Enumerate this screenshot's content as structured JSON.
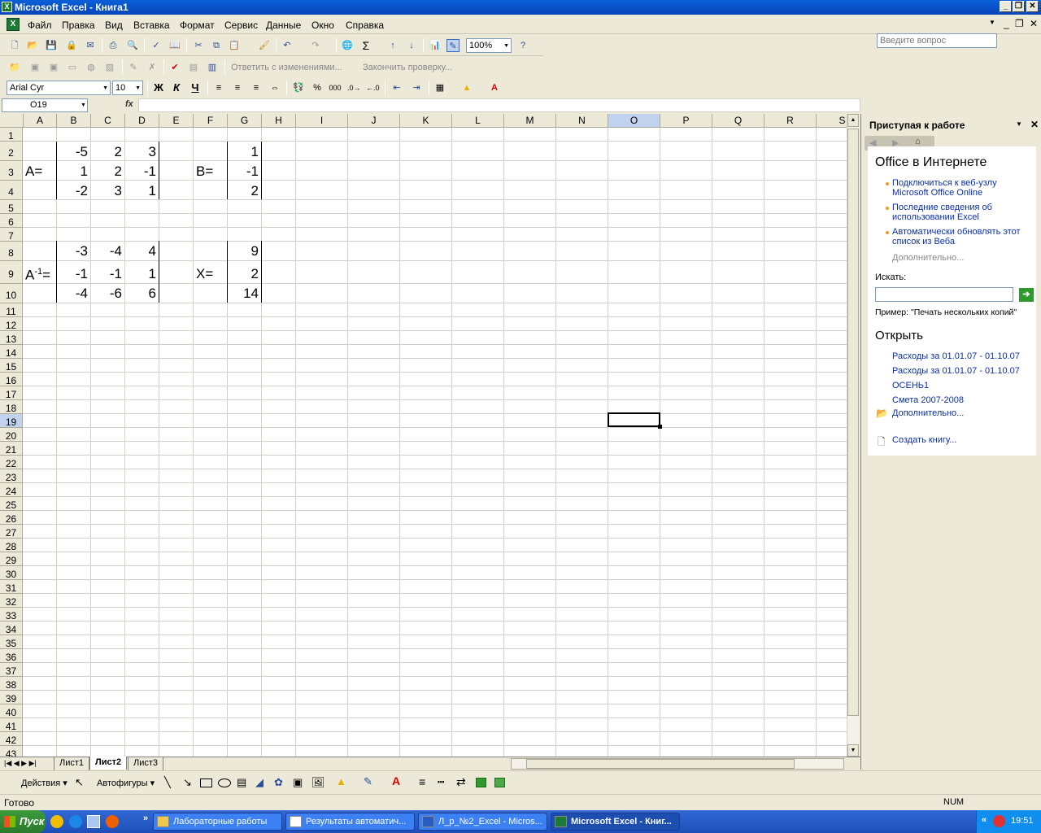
{
  "window": {
    "title": "Microsoft Excel - Книга1"
  },
  "menu": {
    "items": [
      "Файл",
      "Правка",
      "Вид",
      "Вставка",
      "Формат",
      "Сервис",
      "Данные",
      "Окно",
      "Справка"
    ],
    "ask_placeholder": "Введите вопрос"
  },
  "toolbar": {
    "zoom": "100%",
    "reviewing": {
      "reply_label": "Ответить с изменениями...",
      "end_label": "Закончить проверку..."
    },
    "font": "Arial Cyr",
    "font_size": "10",
    "bold": "Ж",
    "italic": "К",
    "underline": "Ч",
    "percent": "%",
    "thousands": "000",
    "sigma": "Σ"
  },
  "formula_bar": {
    "name_box": "O19",
    "fx": "fx",
    "formula": ""
  },
  "sheet": {
    "columns": [
      "A",
      "B",
      "C",
      "D",
      "E",
      "F",
      "G",
      "H",
      "I",
      "J",
      "K",
      "L",
      "M",
      "N",
      "O",
      "P",
      "Q",
      "R",
      "S"
    ],
    "rows": [
      "1",
      "2",
      "3",
      "4",
      "5",
      "6",
      "7",
      "8",
      "9",
      "10",
      "11",
      "12",
      "13",
      "14",
      "15",
      "16",
      "17",
      "18",
      "19",
      "20",
      "21",
      "22",
      "23",
      "24",
      "25",
      "26",
      "27",
      "28",
      "29",
      "30",
      "31",
      "32",
      "33",
      "34",
      "35",
      "36",
      "37",
      "38",
      "39",
      "40",
      "41",
      "42",
      "43"
    ],
    "active_cell": "O19",
    "labels": {
      "a": "A=",
      "b": "B=",
      "ainv": "A",
      "ainv_sup": "-1",
      "ainv_eq": "=",
      "x": "X="
    },
    "matrix_a": [
      [
        "-5",
        "2",
        "3"
      ],
      [
        "1",
        "2",
        "-1"
      ],
      [
        "-2",
        "3",
        "1"
      ]
    ],
    "vector_b": [
      "1",
      "-1",
      "2"
    ],
    "matrix_a_inv": [
      [
        "-3",
        "-4",
        "4"
      ],
      [
        "-1",
        "-1",
        "1"
      ],
      [
        "-4",
        "-6",
        "6"
      ]
    ],
    "vector_x": [
      "9",
      "2",
      "14"
    ]
  },
  "sheet_tabs": {
    "tabs": [
      "Лист1",
      "Лист2",
      "Лист3"
    ],
    "active": "Лист2"
  },
  "task_pane": {
    "title": "Приступая к работе",
    "online_heading": "Office в Интернете",
    "online_links": [
      "Подключиться к веб-узлу Microsoft Office Online",
      "Последние сведения об использовании Excel",
      "Автоматически обновлять этот список из Веба"
    ],
    "more_online": "Дополнительно...",
    "search_label": "Искать:",
    "search_value": "",
    "example": "Пример:  \"Печать нескольких копий\"",
    "open_heading": "Открыть",
    "recent_files": [
      "Расходы за 01.01.07 - 01.10.07",
      "Расходы за 01.01.07 - 01.10.07",
      "ОСЕНЬ1",
      "Смета 2007-2008"
    ],
    "more_files": "Дополнительно...",
    "create_book": "Создать книгу..."
  },
  "drawing": {
    "actions": "Действия",
    "autoshapes": "Автофигуры"
  },
  "status": {
    "ready": "Готово",
    "num": "NUM"
  },
  "taskbar": {
    "start": "Пуск",
    "buttons": [
      "Лабораторные работы",
      "Результаты автоматич...",
      "Л_р_№2_Excel - Micros...",
      "Microsoft Excel - Книг..."
    ],
    "clock": "19:51"
  }
}
